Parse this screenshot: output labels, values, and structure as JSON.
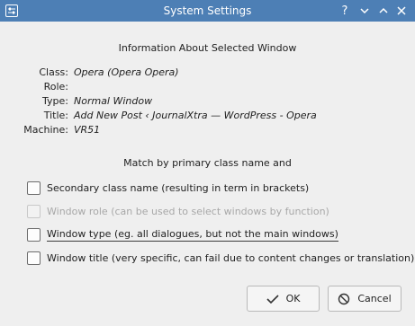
{
  "window": {
    "title": "System Settings",
    "help_symbol": "?"
  },
  "info": {
    "heading": "Information About Selected Window",
    "rows": [
      {
        "label": "Class:",
        "value": "Opera (Opera Opera)"
      },
      {
        "label": "Role:",
        "value": ""
      },
      {
        "label": "Type:",
        "value": "Normal Window"
      },
      {
        "label": "Title:",
        "value": "Add New Post ‹ JournalXtra — WordPress - Opera"
      },
      {
        "label": "Machine:",
        "value": "VR51"
      }
    ]
  },
  "match": {
    "heading": "Match by primary class name and",
    "options": [
      {
        "label": "Secondary class name  (resulting in term in brackets)",
        "checked": false,
        "enabled": true
      },
      {
        "label": "Window role (can be used to select windows by function)",
        "checked": false,
        "enabled": false
      },
      {
        "label": "Window type (eg. all dialogues, but not the main windows)",
        "checked": false,
        "enabled": true
      },
      {
        "label": "Window title (very specific, can fail due to content changes or translation)",
        "checked": false,
        "enabled": true
      }
    ]
  },
  "buttons": {
    "ok_label": "OK",
    "cancel_label": "Cancel"
  },
  "icons": {
    "app": "settings-sliders-icon",
    "help": "help-icon",
    "minimize": "chevron-down-icon",
    "maximize": "chevron-up-icon",
    "close": "close-icon",
    "ok": "checkmark-icon",
    "cancel": "cancel-icon"
  },
  "colors": {
    "titlebar": "#4d7fb5",
    "background": "#efefef"
  }
}
